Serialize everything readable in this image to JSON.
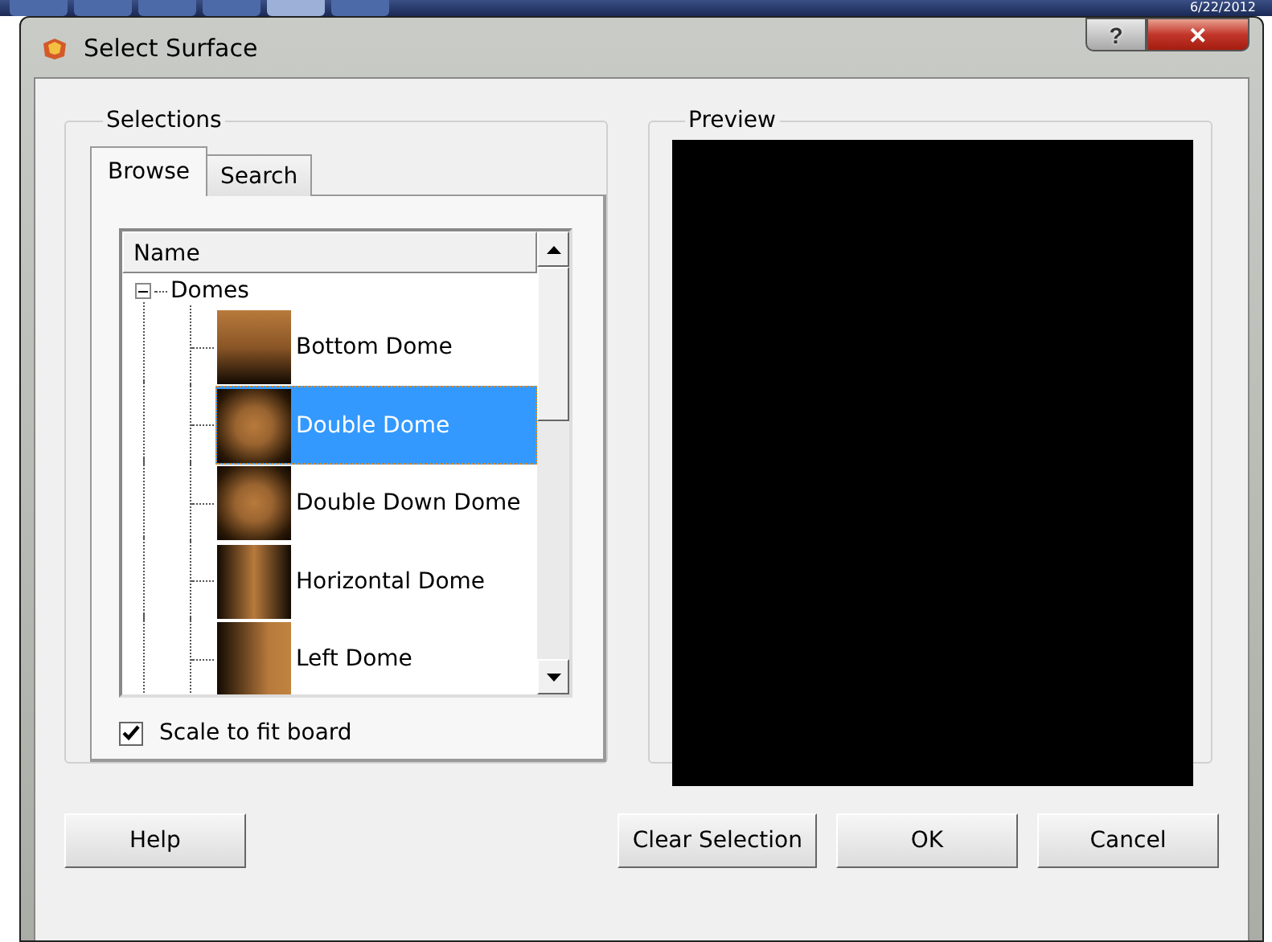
{
  "taskbar": {
    "date": "6/22/2012"
  },
  "window": {
    "title": "Select Surface",
    "caption_buttons": [
      {
        "kind": "help",
        "label": "?"
      },
      {
        "kind": "close",
        "label": "✕"
      }
    ]
  },
  "selections": {
    "title": "Selections",
    "tabs": [
      {
        "label": "Browse",
        "selected": true
      },
      {
        "label": "Search",
        "selected": false
      }
    ],
    "tree": {
      "column": "Name",
      "nodes": [
        {
          "label": "Domes",
          "expanded": true,
          "children": [
            {
              "label": "Bottom Dome",
              "kind": "bottom",
              "selected": false
            },
            {
              "label": "Double Dome",
              "kind": "radial",
              "selected": true
            },
            {
              "label": "Double Down Dome",
              "kind": "radial",
              "selected": false
            },
            {
              "label": "Horizontal Dome",
              "kind": "horizontal",
              "selected": false
            },
            {
              "label": "Left Dome",
              "kind": "left",
              "selected": false
            }
          ]
        }
      ]
    },
    "scale_to_fit": {
      "label": "Scale to fit board",
      "checked": true
    }
  },
  "preview": {
    "title": "Preview"
  },
  "buttons": [
    {
      "label": "Help",
      "kind": "left"
    },
    {
      "label": "Clear Selection",
      "kind": "right"
    },
    {
      "label": "OK",
      "kind": "right"
    },
    {
      "label": "Cancel",
      "kind": "right"
    }
  ]
}
